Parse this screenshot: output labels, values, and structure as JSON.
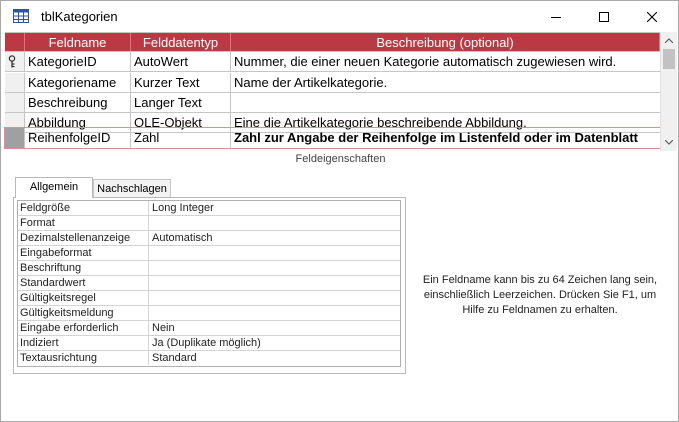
{
  "window": {
    "title": "tblKategorien",
    "icon": "table-icon",
    "controls": {
      "minimize": "minimize-icon",
      "maximize": "maximize-icon",
      "close": "close-icon"
    }
  },
  "grid": {
    "headers": {
      "field_name": "Feldname",
      "data_type": "Felddatentyp",
      "description": "Beschreibung (optional)"
    },
    "header_color": "#ba3a43",
    "rows": [
      {
        "name": "KategorieID",
        "type": "AutoWert",
        "description": "Nummer, die einer neuen Kategorie automatisch zugewiesen wird.",
        "primary_key": true
      },
      {
        "name": "Kategoriename",
        "type": "Kurzer Text",
        "description": "Name der Artikelkategorie."
      },
      {
        "name": "Beschreibung",
        "type": "Langer Text",
        "description": ""
      },
      {
        "name": "Abbildung",
        "type": "OLE-Objekt",
        "description": "Eine die Artikelkategorie beschreibende Abbildung."
      },
      {
        "name": "ReihenfolgeID",
        "type": "Zahl",
        "description": "Zahl zur Angabe der Reihenfolge im Listenfeld oder im Datenblatt",
        "selected": true
      }
    ]
  },
  "field_properties_caption": "Feldeigenschaften",
  "tabs": {
    "general": "Allgemein",
    "lookup": "Nachschlagen"
  },
  "properties": [
    {
      "label": "Feldgröße",
      "value": "Long Integer"
    },
    {
      "label": "Format",
      "value": ""
    },
    {
      "label": "Dezimalstellenanzeige",
      "value": "Automatisch"
    },
    {
      "label": "Eingabeformat",
      "value": ""
    },
    {
      "label": "Beschriftung",
      "value": ""
    },
    {
      "label": "Standardwert",
      "value": ""
    },
    {
      "label": "Gültigkeitsregel",
      "value": ""
    },
    {
      "label": "Gültigkeitsmeldung",
      "value": ""
    },
    {
      "label": "Eingabe erforderlich",
      "value": "Nein"
    },
    {
      "label": "Indiziert",
      "value": "Ja (Duplikate möglich)"
    },
    {
      "label": "Textausrichtung",
      "value": "Standard"
    }
  ],
  "help_text": "Ein Feldname kann bis zu 64 Zeichen lang sein, einschließlich Leerzeichen. Drücken Sie F1, um Hilfe zu Feldnamen zu erhalten."
}
